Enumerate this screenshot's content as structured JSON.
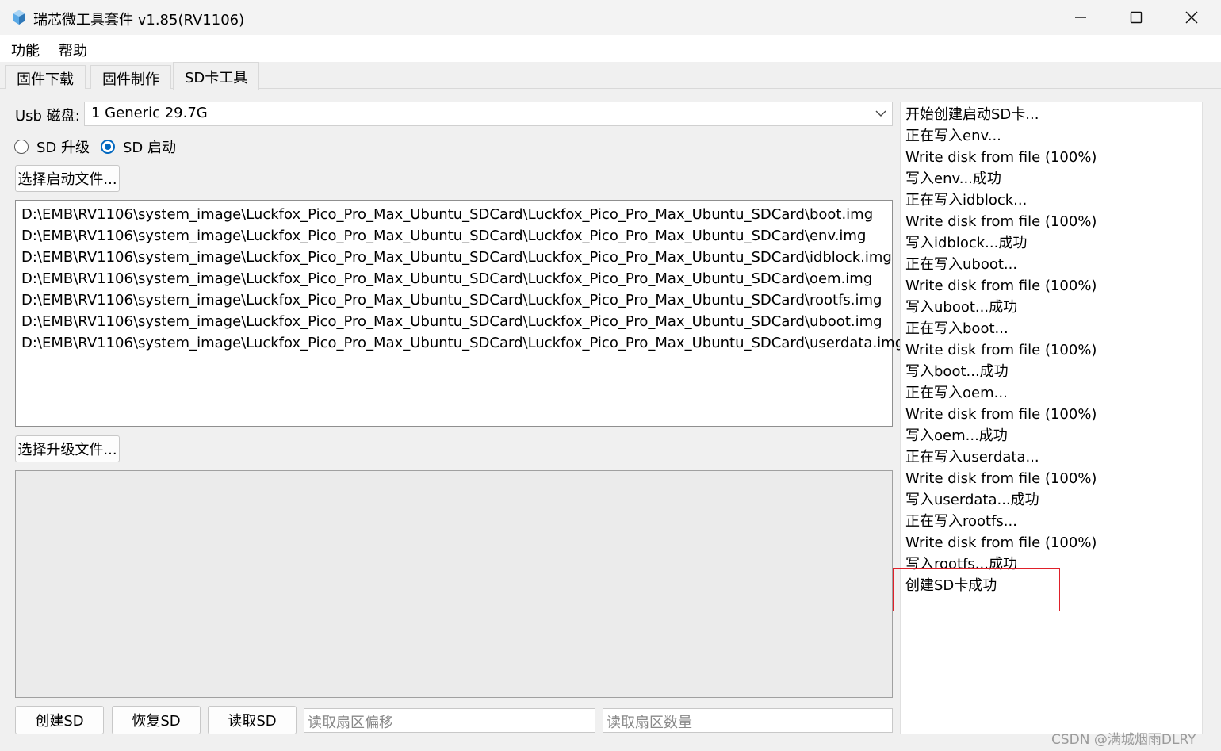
{
  "window": {
    "title": "瑞芯微工具套件 v1.85(RV1106)",
    "icon": "app-icon",
    "controls": {
      "minimize": "minimize-icon",
      "maximize": "maximize-icon",
      "close": "close-icon"
    }
  },
  "menu": {
    "items": [
      "功能",
      "帮助"
    ]
  },
  "tabs": [
    {
      "label": "固件下载",
      "active": false
    },
    {
      "label": "固件制作",
      "active": false
    },
    {
      "label": "SD卡工具",
      "active": true
    }
  ],
  "sd_tool": {
    "usb_label": "Usb 磁盘:",
    "usb_value": "1 Generic 29.7G",
    "radio_upgrade": {
      "label": "SD 升级",
      "checked": false
    },
    "radio_boot": {
      "label": "SD 启动",
      "checked": true
    },
    "select_boot_label": "选择启动文件...",
    "boot_files": [
      "D:\\EMB\\RV1106\\system_image\\Luckfox_Pico_Pro_Max_Ubuntu_SDCard\\Luckfox_Pico_Pro_Max_Ubuntu_SDCard\\boot.img",
      "D:\\EMB\\RV1106\\system_image\\Luckfox_Pico_Pro_Max_Ubuntu_SDCard\\Luckfox_Pico_Pro_Max_Ubuntu_SDCard\\env.img",
      "D:\\EMB\\RV1106\\system_image\\Luckfox_Pico_Pro_Max_Ubuntu_SDCard\\Luckfox_Pico_Pro_Max_Ubuntu_SDCard\\idblock.img",
      "D:\\EMB\\RV1106\\system_image\\Luckfox_Pico_Pro_Max_Ubuntu_SDCard\\Luckfox_Pico_Pro_Max_Ubuntu_SDCard\\oem.img",
      "D:\\EMB\\RV1106\\system_image\\Luckfox_Pico_Pro_Max_Ubuntu_SDCard\\Luckfox_Pico_Pro_Max_Ubuntu_SDCard\\rootfs.img",
      "D:\\EMB\\RV1106\\system_image\\Luckfox_Pico_Pro_Max_Ubuntu_SDCard\\Luckfox_Pico_Pro_Max_Ubuntu_SDCard\\uboot.img",
      "D:\\EMB\\RV1106\\system_image\\Luckfox_Pico_Pro_Max_Ubuntu_SDCard\\Luckfox_Pico_Pro_Max_Ubuntu_SDCard\\userdata.img"
    ],
    "select_upgrade_label": "选择升级文件...",
    "buttons": {
      "create": "创建SD",
      "restore": "恢复SD",
      "read": "读取SD"
    },
    "offset_placeholder": "读取扇区偏移",
    "count_placeholder": "读取扇区数量"
  },
  "log": [
    "开始创建启动SD卡...",
    "正在写入env...",
    "Write disk from file (100%)",
    "写入env...成功",
    "正在写入idblock...",
    "Write disk from file (100%)",
    "写入idblock...成功",
    "正在写入uboot...",
    "Write disk from file (100%)",
    "写入uboot...成功",
    "正在写入boot...",
    "Write disk from file (100%)",
    "写入boot...成功",
    "正在写入oem...",
    "Write disk from file (100%)",
    "写入oem...成功",
    "正在写入userdata...",
    "Write disk from file (100%)",
    "写入userdata...成功",
    "正在写入rootfs...",
    "Write disk from file (100%)",
    "写入rootfs...成功",
    "创建SD卡成功"
  ],
  "highlight_color": "#e0202a",
  "accent_color": "#0067c0",
  "watermark": "CSDN @满城烟雨DLRY"
}
